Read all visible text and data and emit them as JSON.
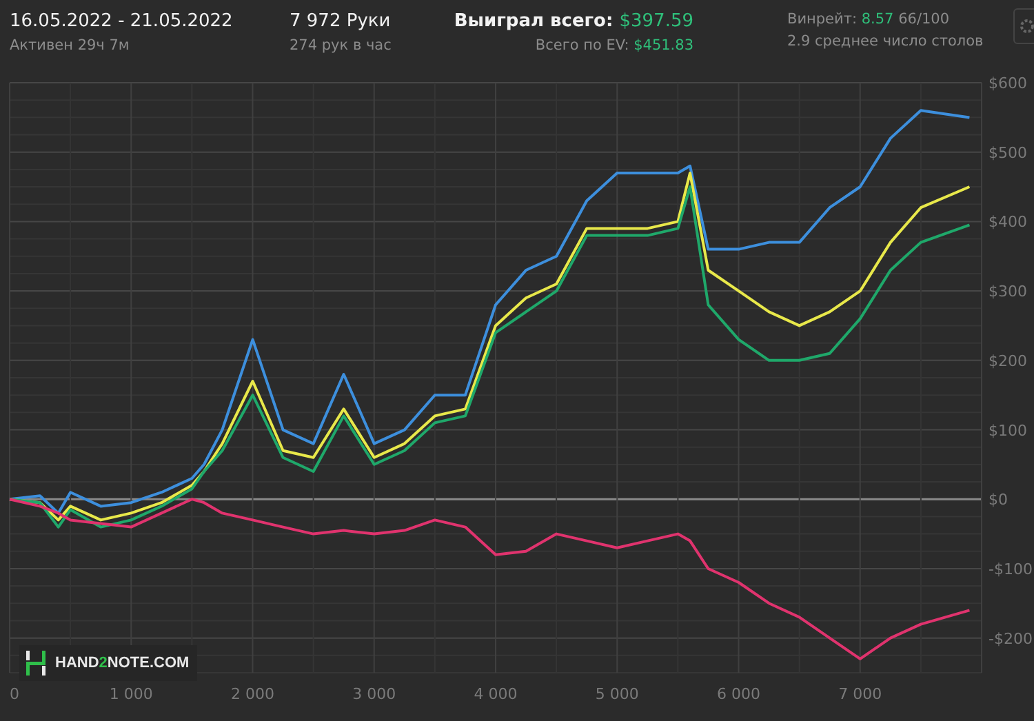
{
  "header": {
    "period": "16.05.2022 - 21.05.2022",
    "active": "Активен 29ч 7м",
    "hands": "7 972 Руки",
    "hands_per_hour": "274 рук в час",
    "won_label": "Выиграл всего:",
    "won_value": "$397.59",
    "ev_label": "Всего по EV:",
    "ev_value": "$451.83",
    "winrate_label": "Винрейт:",
    "winrate_value": "8.57",
    "winrate_unit": "66/100",
    "tables": "2.9 среднее число столов"
  },
  "logo": {
    "parts": [
      "HAND",
      "2",
      "NOTE.COM"
    ]
  },
  "chart_data": {
    "type": "line",
    "x": [
      0,
      250,
      400,
      500,
      750,
      1000,
      1250,
      1500,
      1600,
      1750,
      2000,
      2250,
      2500,
      2750,
      3000,
      3250,
      3500,
      3750,
      4000,
      4250,
      4500,
      4750,
      5000,
      5250,
      5500,
      5600,
      5750,
      6000,
      6250,
      6500,
      6750,
      7000,
      7250,
      7500,
      7900
    ],
    "xticks": [
      {
        "value": 0,
        "label": "0"
      },
      {
        "value": 1000,
        "label": "1 000"
      },
      {
        "value": 2000,
        "label": "2 000"
      },
      {
        "value": 3000,
        "label": "3 000"
      },
      {
        "value": 4000,
        "label": "4 000"
      },
      {
        "value": 5000,
        "label": "5 000"
      },
      {
        "value": 6000,
        "label": "6 000"
      },
      {
        "value": 7000,
        "label": "7 000"
      }
    ],
    "yticks": [
      {
        "value": 600,
        "label": "$600"
      },
      {
        "value": 500,
        "label": "$500"
      },
      {
        "value": 400,
        "label": "$400"
      },
      {
        "value": 300,
        "label": "$300"
      },
      {
        "value": 200,
        "label": "$200"
      },
      {
        "value": 100,
        "label": "$100"
      },
      {
        "value": 0,
        "label": "$0"
      },
      {
        "value": -100,
        "label": "-$100"
      },
      {
        "value": -200,
        "label": "-$200"
      }
    ],
    "grid": true,
    "xlim": [
      0,
      8000
    ],
    "ylim": [
      -250,
      600
    ],
    "series": [
      {
        "color": "#3d8fdd",
        "values": [
          0,
          5,
          -20,
          10,
          -10,
          -5,
          10,
          30,
          50,
          100,
          230,
          100,
          80,
          180,
          80,
          100,
          150,
          150,
          280,
          330,
          350,
          430,
          470,
          470,
          470,
          480,
          360,
          360,
          370,
          370,
          420,
          450,
          520,
          560,
          550
        ]
      },
      {
        "color": "#e8e84a",
        "values": [
          0,
          -5,
          -30,
          -10,
          -30,
          -20,
          -5,
          20,
          40,
          80,
          170,
          70,
          60,
          130,
          60,
          80,
          120,
          130,
          250,
          290,
          310,
          390,
          390,
          390,
          400,
          470,
          330,
          300,
          270,
          250,
          270,
          300,
          370,
          420,
          450
        ]
      },
      {
        "color": "#1fa86a",
        "values": [
          0,
          -5,
          -40,
          -15,
          -40,
          -30,
          -10,
          15,
          40,
          70,
          150,
          60,
          40,
          120,
          50,
          70,
          110,
          120,
          240,
          270,
          300,
          380,
          380,
          380,
          390,
          450,
          280,
          230,
          200,
          200,
          210,
          260,
          330,
          370,
          395
        ]
      },
      {
        "color": "#e0336e",
        "values": [
          0,
          -10,
          -20,
          -30,
          -35,
          -40,
          -20,
          0,
          -5,
          -20,
          -30,
          -40,
          -50,
          -45,
          -50,
          -45,
          -30,
          -40,
          -80,
          -75,
          -50,
          -60,
          -70,
          -60,
          -50,
          -60,
          -100,
          -120,
          -150,
          -170,
          -200,
          -230,
          -200,
          -180,
          -160
        ]
      }
    ]
  }
}
